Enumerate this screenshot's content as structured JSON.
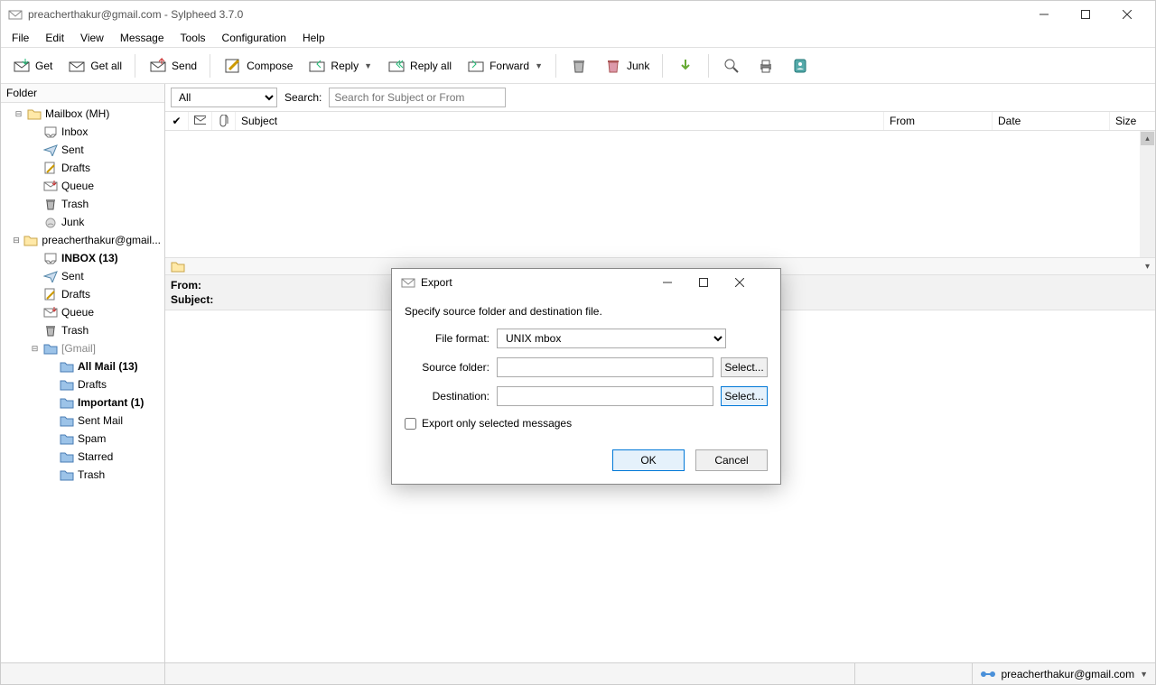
{
  "title": "preacherthakur@gmail.com - Sylpheed 3.7.0",
  "menu": {
    "file": "File",
    "edit": "Edit",
    "view": "View",
    "message": "Message",
    "tools": "Tools",
    "configuration": "Configuration",
    "help": "Help"
  },
  "toolbar": {
    "get": "Get",
    "get_all": "Get all",
    "send": "Send",
    "compose": "Compose",
    "reply": "Reply",
    "reply_all": "Reply all",
    "forward": "Forward",
    "junk": "Junk"
  },
  "sidebar": {
    "header": "Folder",
    "items": [
      {
        "label": "Mailbox (MH)",
        "kind": "mailbox",
        "indent": 0,
        "twisty": "−",
        "bold": false
      },
      {
        "label": "Inbox",
        "kind": "inbox",
        "indent": 1,
        "twisty": "",
        "bold": false
      },
      {
        "label": "Sent",
        "kind": "sent",
        "indent": 1,
        "twisty": "",
        "bold": false
      },
      {
        "label": "Drafts",
        "kind": "drafts",
        "indent": 1,
        "twisty": "",
        "bold": false
      },
      {
        "label": "Queue",
        "kind": "queue",
        "indent": 1,
        "twisty": "",
        "bold": false
      },
      {
        "label": "Trash",
        "kind": "trash",
        "indent": 1,
        "twisty": "",
        "bold": false
      },
      {
        "label": "Junk",
        "kind": "junk",
        "indent": 1,
        "twisty": "",
        "bold": false
      },
      {
        "label": "preacherthakur@gmail...",
        "kind": "account",
        "indent": 0,
        "twisty": "−",
        "bold": false
      },
      {
        "label": "INBOX (13)",
        "kind": "inbox",
        "indent": 1,
        "twisty": "",
        "bold": true
      },
      {
        "label": "Sent",
        "kind": "sent",
        "indent": 1,
        "twisty": "",
        "bold": false
      },
      {
        "label": "Drafts",
        "kind": "drafts",
        "indent": 1,
        "twisty": "",
        "bold": false
      },
      {
        "label": "Queue",
        "kind": "queue",
        "indent": 1,
        "twisty": "",
        "bold": false
      },
      {
        "label": "Trash",
        "kind": "trash",
        "indent": 1,
        "twisty": "",
        "bold": false
      },
      {
        "label": "[Gmail]",
        "kind": "folder",
        "indent": 1,
        "twisty": "−",
        "bold": false,
        "dim": true
      },
      {
        "label": "All Mail (13)",
        "kind": "folder",
        "indent": 2,
        "twisty": "",
        "bold": true
      },
      {
        "label": "Drafts",
        "kind": "folder",
        "indent": 2,
        "twisty": "",
        "bold": false
      },
      {
        "label": "Important (1)",
        "kind": "folder",
        "indent": 2,
        "twisty": "",
        "bold": true
      },
      {
        "label": "Sent Mail",
        "kind": "folder",
        "indent": 2,
        "twisty": "",
        "bold": false
      },
      {
        "label": "Spam",
        "kind": "folder",
        "indent": 2,
        "twisty": "",
        "bold": false
      },
      {
        "label": "Starred",
        "kind": "folder",
        "indent": 2,
        "twisty": "",
        "bold": false
      },
      {
        "label": "Trash",
        "kind": "folder",
        "indent": 2,
        "twisty": "",
        "bold": false
      }
    ]
  },
  "filter": {
    "all": "All",
    "search_label": "Search:",
    "search_placeholder": "Search for Subject or From"
  },
  "cols": {
    "subject": "Subject",
    "from": "From",
    "date": "Date",
    "size": "Size"
  },
  "msg": {
    "from_label": "From:",
    "subject_label": "Subject:"
  },
  "status": {
    "account": "preacherthakur@gmail.com"
  },
  "dialog": {
    "title": "Export",
    "instruction": "Specify source folder and destination file.",
    "file_format_label": "File format:",
    "file_format_value": "UNIX mbox",
    "source_label": "Source folder:",
    "dest_label": "Destination:",
    "select": "Select...",
    "export_only": "Export only selected messages",
    "ok": "OK",
    "cancel": "Cancel"
  }
}
